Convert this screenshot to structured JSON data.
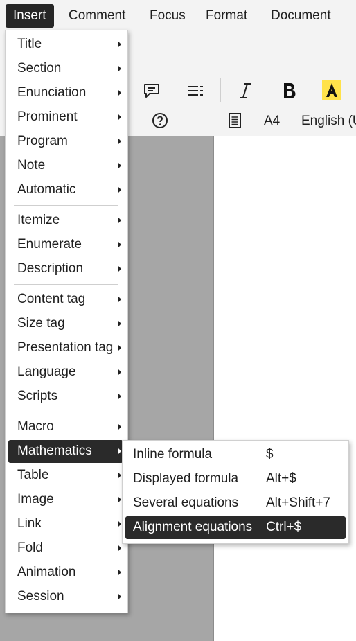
{
  "menubar": {
    "items": [
      "Insert",
      "Comment",
      "Focus",
      "Format",
      "Document"
    ],
    "active": "Insert"
  },
  "statusbar": {
    "page_size": "A4",
    "language": "English (U"
  },
  "insert_menu": {
    "items": [
      {
        "label": "Title"
      },
      {
        "label": "Section"
      },
      {
        "label": "Enunciation"
      },
      {
        "label": "Prominent"
      },
      {
        "label": "Program"
      },
      {
        "label": "Note"
      },
      {
        "label": "Automatic"
      },
      {
        "label": "Itemize"
      },
      {
        "label": "Enumerate"
      },
      {
        "label": "Description"
      },
      {
        "label": "Content tag"
      },
      {
        "label": "Size tag"
      },
      {
        "label": "Presentation tag"
      },
      {
        "label": "Language"
      },
      {
        "label": "Scripts"
      },
      {
        "label": "Macro"
      },
      {
        "label": "Mathematics"
      },
      {
        "label": "Table"
      },
      {
        "label": "Image"
      },
      {
        "label": "Link"
      },
      {
        "label": "Fold"
      },
      {
        "label": "Animation"
      },
      {
        "label": "Session"
      }
    ],
    "highlighted": "Mathematics"
  },
  "math_submenu": {
    "items": [
      {
        "label": "Inline formula",
        "shortcut": "$"
      },
      {
        "label": "Displayed formula",
        "shortcut": "Alt+$"
      },
      {
        "label": "Several equations",
        "shortcut": "Alt+Shift+7"
      },
      {
        "label": "Alignment equations",
        "shortcut": "Ctrl+$"
      }
    ],
    "highlighted": "Alignment equations"
  },
  "colors": {
    "highlight_bg": "#2a2a2a",
    "highlight_marker": "#ffe24a",
    "doc_background": "#a6a6a6"
  }
}
